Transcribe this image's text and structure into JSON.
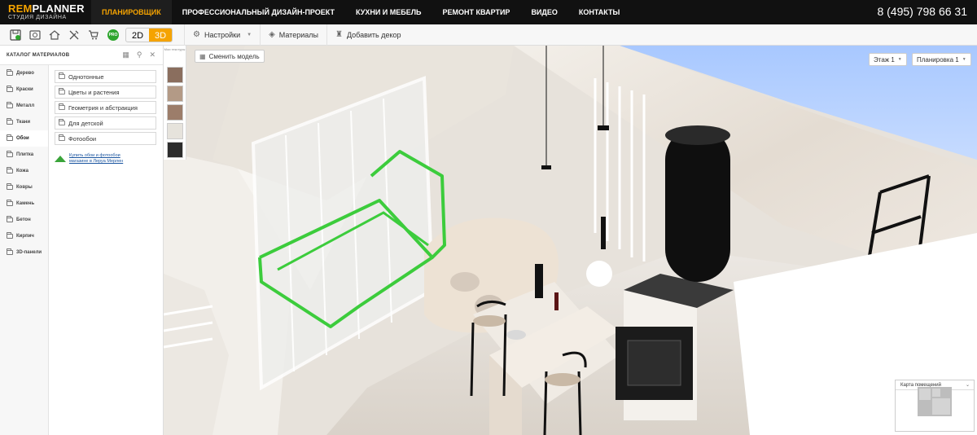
{
  "brand": {
    "name_a": "REM",
    "name_b": "PLANNER",
    "subtitle": "СТУДИЯ ДИЗАЙНА"
  },
  "nav": [
    {
      "label": "ПЛАНИРОВЩИК",
      "active": true
    },
    {
      "label": "ПРОФЕССИОНАЛЬНЫЙ ДИЗАЙН-ПРОЕКТ"
    },
    {
      "label": "КУХНИ И МЕБЕЛЬ"
    },
    {
      "label": "РЕМОНТ КВАРТИР"
    },
    {
      "label": "ВИДЕО"
    },
    {
      "label": "КОНТАКТЫ"
    }
  ],
  "phone": "8 (495) 798 66 31",
  "toolbar": {
    "pro_badge": "PRO",
    "view_2d": "2D",
    "view_3d": "3D",
    "settings": "Настройки",
    "materials": "Материалы",
    "add_decor": "Добавить декор"
  },
  "catalog": {
    "title": "КАТАЛОГ МАТЕРИАЛОВ",
    "categories": [
      "Дерево",
      "Краски",
      "Металл",
      "Ткани",
      "Обои",
      "Плитка",
      "Кожа",
      "Ковры",
      "Камень",
      "Бетон",
      "Кирпич",
      "3D-панели"
    ],
    "active_category": "Обои",
    "subcategories": [
      "Однотонные",
      "Цветы и растения",
      "Геометрия и абстракция",
      "Для детской",
      "Фотообои"
    ],
    "promo_line1": "Купить обои и фотообои",
    "promo_line2": "магазине в Леруа Мерлен"
  },
  "swatches": {
    "label": "Мои текстуры",
    "colors": [
      "#8a6e5e",
      "#b39a86",
      "#9c7d6a",
      "#e6e3dc",
      "#2c2c2c"
    ]
  },
  "viewport": {
    "change_model": "Сменить модель",
    "floor": "Этаж 1",
    "layout": "Планировка 1",
    "room_map": "Карта помещений"
  },
  "colors": {
    "accent": "#f5a300",
    "green": "#2da52d",
    "selection": "#3ccc3c"
  }
}
